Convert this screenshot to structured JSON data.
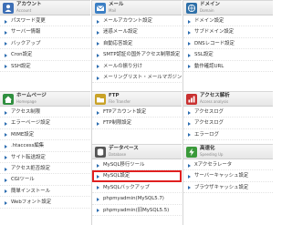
{
  "columns": [
    {
      "sections": [
        {
          "title": "アカウント",
          "sub": "Account",
          "icon": "account-icon",
          "icon_color": "#3d6fb6",
          "items": [
            "パスワード変更",
            "サーバー情報",
            "バックアップ",
            "Cron設定",
            "SSH設定"
          ]
        },
        {
          "title": "ホームページ",
          "sub": "Homepage",
          "icon": "homepage-icon",
          "icon_color": "#2f8f3f",
          "items": [
            "アクセス制限",
            "エラーページ設定",
            "MIME設定",
            ".htaccess編集",
            "サイト転送設定",
            "アクセス拒否設定",
            "CGIツール",
            "簡単インストール",
            "Webフォント設定"
          ]
        }
      ]
    },
    {
      "sections": [
        {
          "title": "メール",
          "sub": "Mail",
          "icon": "mail-icon",
          "icon_color": "#3b7fc4",
          "items": [
            "メールアカウント設定",
            "迷惑メール設定",
            "自動応答設定",
            "SMTP認証の国外アクセス制限設定",
            "メールの振り分け",
            "メーリングリスト・メールマガジン"
          ]
        },
        {
          "title": "FTP",
          "sub": "File Transfer",
          "icon": "ftp-icon",
          "icon_color": "#c9a227",
          "items": [
            "FTPアカウント設定",
            "FTP制限設定"
          ]
        },
        {
          "title": "データベース",
          "sub": "Database",
          "icon": "database-icon",
          "icon_color": "#555555",
          "items": [
            "MySQL移行ツール",
            "MySQL設定",
            "MySQLバックアップ",
            "phpmyadmin(MySQL5.7)",
            "phpmyadmin(旧MySQL5.5)"
          ]
        }
      ]
    },
    {
      "sections": [
        {
          "title": "ドメイン",
          "sub": "Domain",
          "icon": "domain-icon",
          "icon_color": "#2d6fa8",
          "items": [
            "ドメイン設定",
            "サブドメイン設定",
            "DNSレコード設定",
            "SSL設定",
            "動作確認URL"
          ]
        },
        {
          "title": "アクセス解析",
          "sub": "Access analysis",
          "icon": "analysis-icon",
          "icon_color": "#c93030",
          "items": [
            "アクセスログ",
            "アクセスログ",
            "エラーログ"
          ]
        },
        {
          "title": "高速化",
          "sub": "Speeding Up",
          "icon": "speedup-icon",
          "icon_color": "#3a9a3a",
          "items": [
            "Xアクセラレータ",
            "サーバーキャッシュ設定",
            "ブラウザキャッシュ設定"
          ]
        }
      ]
    }
  ],
  "highlighted_item": "MySQL設定"
}
